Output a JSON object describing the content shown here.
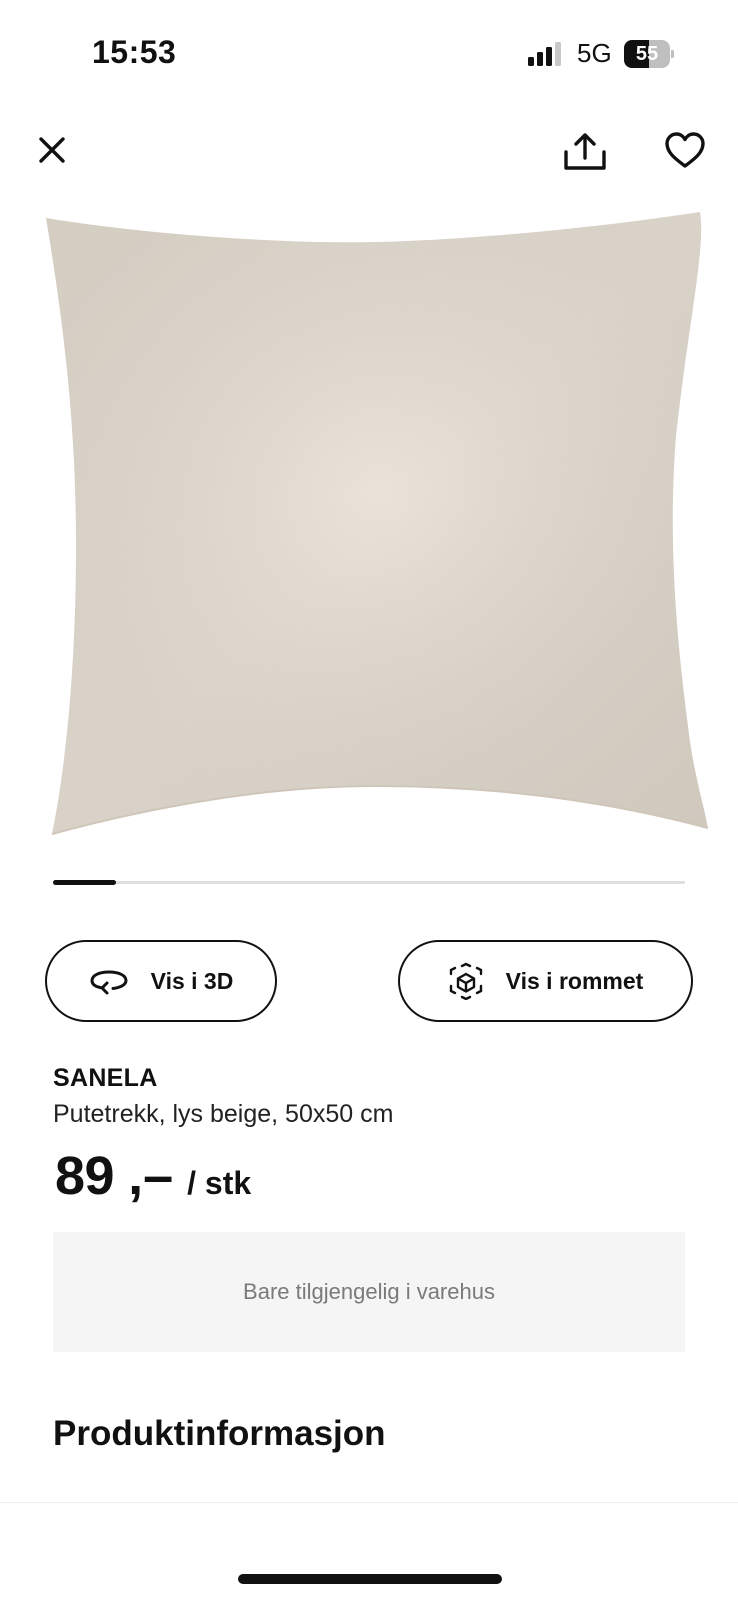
{
  "status_bar": {
    "time": "15:53",
    "network": "5G",
    "battery_level": "55",
    "battery_fraction": 0.55,
    "signal_bars_filled": 3,
    "signal_bars_total": 4
  },
  "top_bar": {
    "close_icon": "close-icon",
    "share_icon": "share-icon",
    "favorite_icon": "heart-icon"
  },
  "gallery": {
    "image_subject": "light beige cushion cover",
    "image_color": "#e4dcd1",
    "active_index_fraction": 0.1,
    "image_count_fraction_start": 0.0
  },
  "actions": {
    "view_3d_label": "Vis i 3D",
    "view_room_label": "Vis i rommet",
    "view_3d_icon": "rotate-3d-icon",
    "view_room_icon": "ar-cube-icon"
  },
  "product": {
    "name": "SANELA",
    "description": "Putetrekk, lys beige, 50x50 cm",
    "price": "89",
    "price_suffix": ",–",
    "unit": "/ stk",
    "availability": "Bare tilgjengelig i varehus"
  },
  "sections": {
    "product_info_title": "Produktinformasjon"
  },
  "colors": {
    "accent": "#111111",
    "availability_bg": "#f5f5f5",
    "availability_text": "#7a7a7a"
  }
}
